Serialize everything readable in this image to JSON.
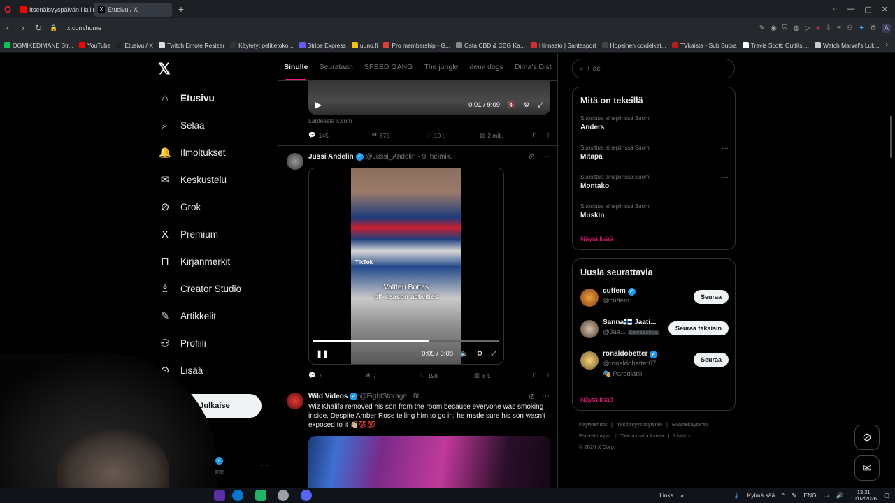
{
  "browser": {
    "tabs": [
      {
        "label": "Itsenäisyyspäivän illalliner"
      },
      {
        "label": "Etusivu / X"
      }
    ],
    "url": "x.com/home",
    "bookmarks": [
      {
        "label": "OGMIKEDIMANE Str...",
        "color": "#00c853"
      },
      {
        "label": "YouTube",
        "color": "#ff0000"
      },
      {
        "label": "Etusivu / X",
        "color": "#222222"
      },
      {
        "label": "Twitch Emote Resizer",
        "color": "#dddddd"
      },
      {
        "label": "Käytetyt pelitietoko...",
        "color": "#333333"
      },
      {
        "label": "Stripe Express",
        "color": "#635bff"
      },
      {
        "label": "uuno.fi",
        "color": "#f4c20d"
      },
      {
        "label": "Pro membership - G...",
        "color": "#e53935"
      },
      {
        "label": "Osta CBD & CBG Ka...",
        "color": "#888888"
      },
      {
        "label": "Hinnasto | Santasport",
        "color": "#d32f2f"
      },
      {
        "label": "Hopeinen cordelket...",
        "color": "#444444"
      },
      {
        "label": "TVkaista - Sub Suora",
        "color": "#b71c1c"
      },
      {
        "label": "Travis Scott: Outfits,...",
        "color": "#ffffff"
      },
      {
        "label": "Watch Marvel's Luk...",
        "color": "#cccccc"
      }
    ]
  },
  "nav": {
    "items": [
      {
        "label": "Etusivu",
        "icon": "⌂"
      },
      {
        "label": "Selaa",
        "icon": "⌕"
      },
      {
        "label": "Ilmoitukset",
        "icon": "🔔"
      },
      {
        "label": "Keskustelu",
        "icon": "✉"
      },
      {
        "label": "Grok",
        "icon": "⊘"
      },
      {
        "label": "Premium",
        "icon": "X"
      },
      {
        "label": "Kirjanmerkit",
        "icon": "⊓"
      },
      {
        "label": "Creator Studio",
        "icon": "♗"
      },
      {
        "label": "Artikkelit",
        "icon": "✎"
      },
      {
        "label": "Profiili",
        "icon": "⚇"
      },
      {
        "label": "Lisää",
        "icon": "⊙"
      }
    ],
    "post_label": "Julkaise",
    "account_handle_fragment": "ine"
  },
  "feed": {
    "tabs": [
      "Sinulle",
      "Seurataan",
      "SPEED GANG",
      "The jungle",
      "demi dogs",
      "Dima's Dist"
    ],
    "tweet1": {
      "time": "0:01 / 9:09",
      "source": "Lähteestä x.com",
      "stats": {
        "replies": "145",
        "reposts": "675",
        "likes": "10 t.",
        "views": "2 milj."
      }
    },
    "tweet2": {
      "name": "Jussi Andelin",
      "handle": "@Jussi_Andelin",
      "date": "· 9. helmik.",
      "tiktok": "TikTok",
      "caption_line1": "Valtteri Bottas",
      "caption_line2": "off-season activities",
      "time": "0:05 / 0:08",
      "progress": 0.62,
      "stats": {
        "replies": "7",
        "reposts": "7",
        "likes": "198",
        "views": "8 t."
      }
    },
    "tweet3": {
      "name": "Wild Videos",
      "handle": "@FightStorage",
      "date": "· 6t",
      "text": "Wiz Khalifa removed his son from the room because everyone was smoking inside. Despite Amber Rose telling him to go in, he made sure his son wasn't exposed to it 👏🏼💯💯"
    }
  },
  "right": {
    "search_placeholder": "Hae",
    "trends_title": "Mitä on tekeillä",
    "trends": [
      {
        "context": "Suosittua aihepiirissä Suomi",
        "topic": "Anders"
      },
      {
        "context": "Suosittua aihepiirissä Suomi",
        "topic": "Mitäpä"
      },
      {
        "context": "Suosittua aihepiirissä Suomi",
        "topic": "Montako"
      },
      {
        "context": "Suosittua aihepiirissä Suomi",
        "topic": "Muskin"
      }
    ],
    "show_more": "Näytä lisää",
    "who_title": "Uusia seurattavia",
    "who": [
      {
        "name": "cuffem",
        "handle": "@cuffem",
        "button": "Seuraa",
        "verified": true
      },
      {
        "name": "Sanna🇫🇮 Jaati...",
        "handle": "@Jaa...",
        "extra": "Seuraa sinua",
        "button": "Seuraa takaisin",
        "verified": false
      },
      {
        "name": "ronaldobetter",
        "handle": "@ronaldobetter07",
        "note": "🎭 Parodiatili",
        "button": "Seuraa",
        "verified": true
      }
    ],
    "footer": {
      "row1": [
        "Käyttöehdot",
        "Yksityisyyskäytäntö",
        "Evästekäytäntö"
      ],
      "row2": [
        "Esteettömyys",
        "Tietoa mainoksista",
        "Lisää ···"
      ],
      "copyright": "© 2026 X Corp."
    }
  },
  "taskbar": {
    "links": "Links",
    "weather": "Kylmä sää",
    "lang": "ENG",
    "time": "13.31",
    "date": "10/02/2026"
  },
  "colors": {
    "accent": "#f91880",
    "verified": "#1d9bf0",
    "background": "#000000"
  }
}
